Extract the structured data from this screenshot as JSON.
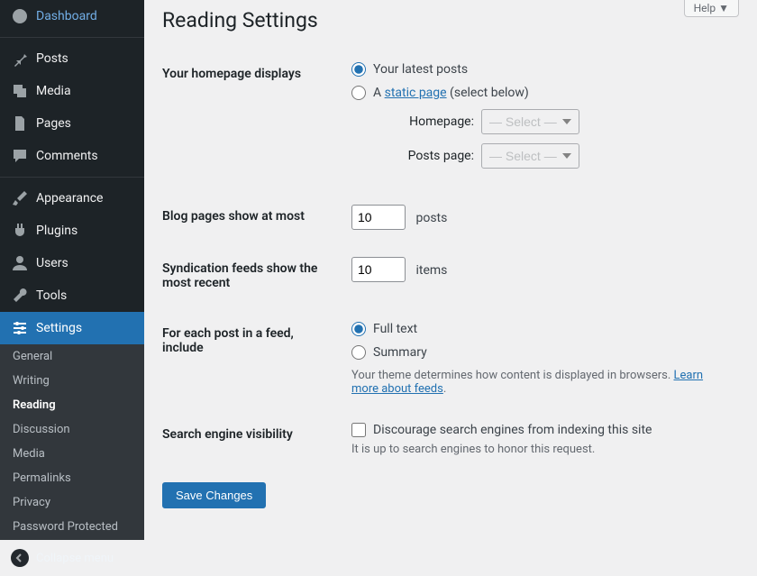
{
  "sidebar": {
    "items": [
      {
        "label": "Dashboard",
        "icon": "dashboard"
      },
      {
        "label": "Posts",
        "icon": "pin"
      },
      {
        "label": "Media",
        "icon": "media"
      },
      {
        "label": "Pages",
        "icon": "pages"
      },
      {
        "label": "Comments",
        "icon": "comments"
      },
      {
        "label": "Appearance",
        "icon": "brush"
      },
      {
        "label": "Plugins",
        "icon": "plug"
      },
      {
        "label": "Users",
        "icon": "user"
      },
      {
        "label": "Tools",
        "icon": "wrench"
      },
      {
        "label": "Settings",
        "icon": "sliders"
      }
    ],
    "submenu": [
      {
        "label": "General"
      },
      {
        "label": "Writing"
      },
      {
        "label": "Reading",
        "current": true
      },
      {
        "label": "Discussion"
      },
      {
        "label": "Media"
      },
      {
        "label": "Permalinks"
      },
      {
        "label": "Privacy"
      },
      {
        "label": "Password Protected"
      }
    ],
    "collapse": "Collapse menu"
  },
  "help_label": "Help ▼",
  "page_title": "Reading Settings",
  "homepage_label": "Your homepage displays",
  "homepage_opt_latest": "Your latest posts",
  "homepage_opt_static_prefix": "A ",
  "homepage_opt_static_link": "static page",
  "homepage_opt_static_suffix": " (select below)",
  "homepage_select_label": "Homepage:",
  "postspage_select_label": "Posts page:",
  "select_placeholder": "— Select —",
  "blog_pages_label": "Blog pages show at most",
  "blog_pages_value": 10,
  "posts_unit": "posts",
  "syndication_label": "Syndication feeds show the most recent",
  "syndication_value": 10,
  "items_unit": "items",
  "feed_include_label": "For each post in a feed, include",
  "feed_full": "Full text",
  "feed_summary": "Summary",
  "feed_desc_prefix": "Your theme determines how content is displayed in browsers. ",
  "feed_desc_link": "Learn more about feeds",
  "search_vis_label": "Search engine visibility",
  "search_vis_checkbox": "Discourage search engines from indexing this site",
  "search_vis_desc": "It is up to search engines to honor this request.",
  "save_label": "Save Changes"
}
